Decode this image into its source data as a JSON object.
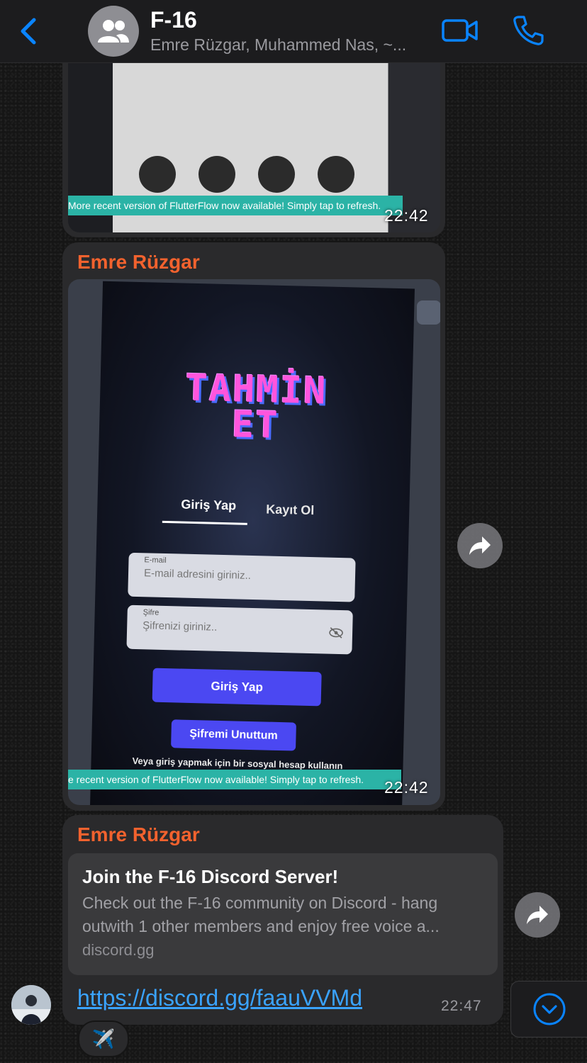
{
  "header": {
    "back_label": "Back",
    "title": "F-16",
    "subtitle": "Emre Rüzgar, Muhammed Nas, ~...",
    "icons": [
      "chevron-left-icon",
      "group-avatar-icon",
      "video-call-icon",
      "phone-icon"
    ],
    "accent_color": "#0a84ff"
  },
  "messages": [
    {
      "type": "image",
      "time": "22:42",
      "banner": "More recent version of FlutterFlow now available! Simply tap to refresh."
    },
    {
      "type": "image",
      "sender": "Emre Rüzgar",
      "sender_color": "#f2622e",
      "time": "22:42",
      "screen": {
        "logo_line1": "TAHMİN",
        "logo_line2": "ET",
        "tab_login": "Giriş Yap",
        "tab_register": "Kayıt Ol",
        "email_label": "E-mail",
        "email_placeholder": "E-mail adresini giriniz..",
        "password_label": "Şifre",
        "password_placeholder": "Şifrenizi giriniz..",
        "login_button": "Giriş Yap",
        "forgot_button": "Şifremi Unuttum",
        "social_text": "Veya giriş yapmak için bir sosyal hesap kullanın",
        "banner": "e recent version of FlutterFlow now available! Simply tap to refresh."
      }
    },
    {
      "type": "link",
      "sender": "Emre Rüzgar",
      "preview_title": "Join the F-16 Discord Server!",
      "preview_desc": "Check out the F-16 community on Discord - hang outwith 1 other members and enjoy free voice a...",
      "preview_domain": "discord.gg",
      "url": "https://discord.gg/faauVVMd",
      "time": "22:47",
      "reaction": "✈️"
    }
  ]
}
